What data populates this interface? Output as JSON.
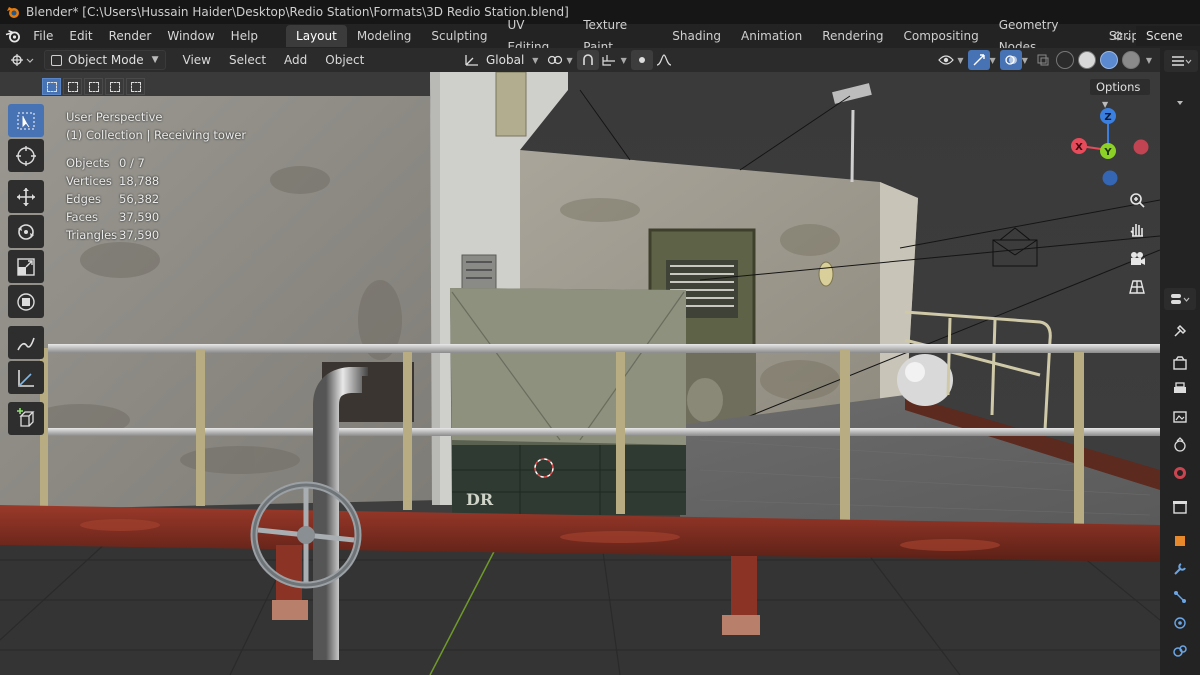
{
  "window": {
    "title": "Blender* [C:\\Users\\Hussain Haider\\Desktop\\Redio Station\\Formats\\3D Redio Station.blend]"
  },
  "menu": {
    "items": [
      "File",
      "Edit",
      "Render",
      "Window",
      "Help"
    ]
  },
  "workspaces": {
    "tabs": [
      "Layout",
      "Modeling",
      "Sculpting",
      "UV Editing",
      "Texture Paint",
      "Shading",
      "Animation",
      "Rendering",
      "Compositing",
      "Geometry Nodes",
      "Scripting"
    ],
    "active": "Layout",
    "add": "+"
  },
  "scene": {
    "name": "Scene"
  },
  "viewport_header": {
    "mode": "Object Mode",
    "menus": [
      "View",
      "Select",
      "Add",
      "Object"
    ],
    "orientation": "Global"
  },
  "viewport": {
    "options_label": "Options",
    "perspective": "User Perspective",
    "collection": "(1) Collection | Receiving tower",
    "stats": [
      {
        "label": "Objects",
        "value": "0 / 7"
      },
      {
        "label": "Vertices",
        "value": "18,788"
      },
      {
        "label": "Edges",
        "value": "56,382"
      },
      {
        "label": "Faces",
        "value": "37,590"
      },
      {
        "label": "Triangles",
        "value": "37,590"
      }
    ],
    "crate_label": "DR"
  },
  "gizmo": {
    "z": "Z",
    "y": "Y",
    "x": "X"
  },
  "colors": {
    "accent": "#4772b3",
    "axis_x": "#e54b5b",
    "axis_y": "#8bd126",
    "axis_z": "#3b80e0"
  }
}
